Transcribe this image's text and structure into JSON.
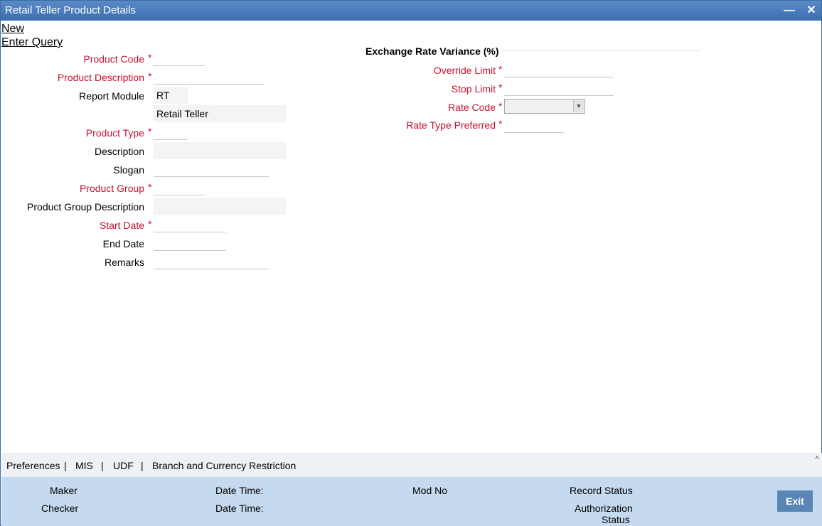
{
  "window": {
    "title": "Retail Teller Product Details",
    "minimize_glyph": "—",
    "close_glyph": "✕"
  },
  "actions": {
    "new_label": "New",
    "enter_query_label": "Enter Query"
  },
  "left_form": {
    "product_code_label": "Product Code",
    "product_description_label": "Product Description",
    "report_module_label": "Report Module",
    "report_module_value": "RT",
    "report_module_desc": "Retail Teller",
    "product_type_label": "Product Type",
    "description_label": "Description",
    "slogan_label": "Slogan",
    "product_group_label": "Product Group",
    "product_group_description_label": "Product Group Description",
    "start_date_label": "Start Date",
    "end_date_label": "End Date",
    "remarks_label": "Remarks",
    "required_mark": "*"
  },
  "exchange": {
    "section_title": "Exchange Rate Variance (%)",
    "override_limit_label": "Override Limit",
    "stop_limit_label": "Stop Limit",
    "rate_code_label": "Rate Code",
    "rate_type_preferred_label": "Rate Type Preferred",
    "rate_code_selected": ""
  },
  "tabs": {
    "items": [
      "Preferences",
      "MIS",
      "UDF",
      "Branch and Currency Restriction"
    ],
    "separator": "|",
    "collapse_glyph": "^"
  },
  "footer": {
    "maker_label": "Maker",
    "checker_label": "Checker",
    "date_time_label": "Date Time:",
    "mod_no_label": "Mod No",
    "record_status_label": "Record Status",
    "authorization_label": "Authorization",
    "status_label": "Status",
    "exit_label": "Exit"
  },
  "colors": {
    "titlebar": "#3b6db0",
    "required": "#c8102e",
    "footer_bg": "#c5d9ef",
    "exit_button": "#5a86b5"
  }
}
